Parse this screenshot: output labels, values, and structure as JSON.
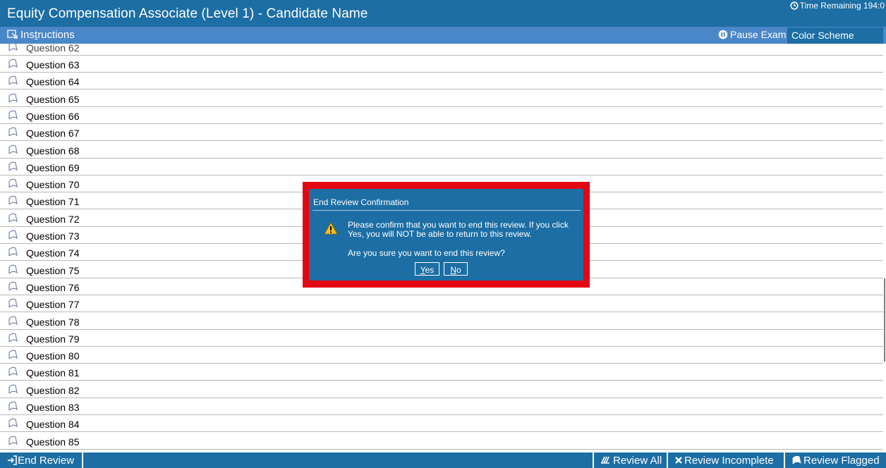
{
  "header": {
    "title": "Equity Compensation Associate (Level 1) - Candidate Name",
    "timer": "Time Remaining 194:0",
    "timer_icon": "clock-icon"
  },
  "menu": {
    "instructions": {
      "accel": "Ins",
      "accel_under": "t",
      "rest": "ructions"
    },
    "pause": "Pause Exam",
    "color_scheme": "Color Scheme"
  },
  "questions": {
    "partial_top": "Question 62",
    "items": [
      "Question 63",
      "Question 64",
      "Question 65",
      "Question 66",
      "Question 67",
      "Question 68",
      "Question 69",
      "Question 70",
      "Question 71",
      "Question 72",
      "Question 73",
      "Question 74",
      "Question 75",
      "Question 76",
      "Question 77",
      "Question 78",
      "Question 79",
      "Question 80",
      "Question 81",
      "Question 82",
      "Question 83",
      "Question 84",
      "Question 85"
    ],
    "flag_icon": "flag-outline-icon"
  },
  "dialog": {
    "title": "End Review Confirmation",
    "message_line1": "Please confirm that you want to end this review.  If you click",
    "message_line2": "Yes, you will NOT be able to return to this review.",
    "question": "Are you sure you want to end this review?",
    "yes": {
      "underlined": "Y",
      "rest": "es"
    },
    "no": {
      "underlined": "N",
      "rest": "o"
    },
    "warning_icon": "warning-icon",
    "frame_color": "#e30613"
  },
  "footer": {
    "end_review": "End Review",
    "review_all": "Review All",
    "review_incomplete": "Review Incomplete",
    "review_flagged": "Review Flagged"
  },
  "colors": {
    "primary": "#1c6ea4",
    "menu": "#4a87c8"
  }
}
